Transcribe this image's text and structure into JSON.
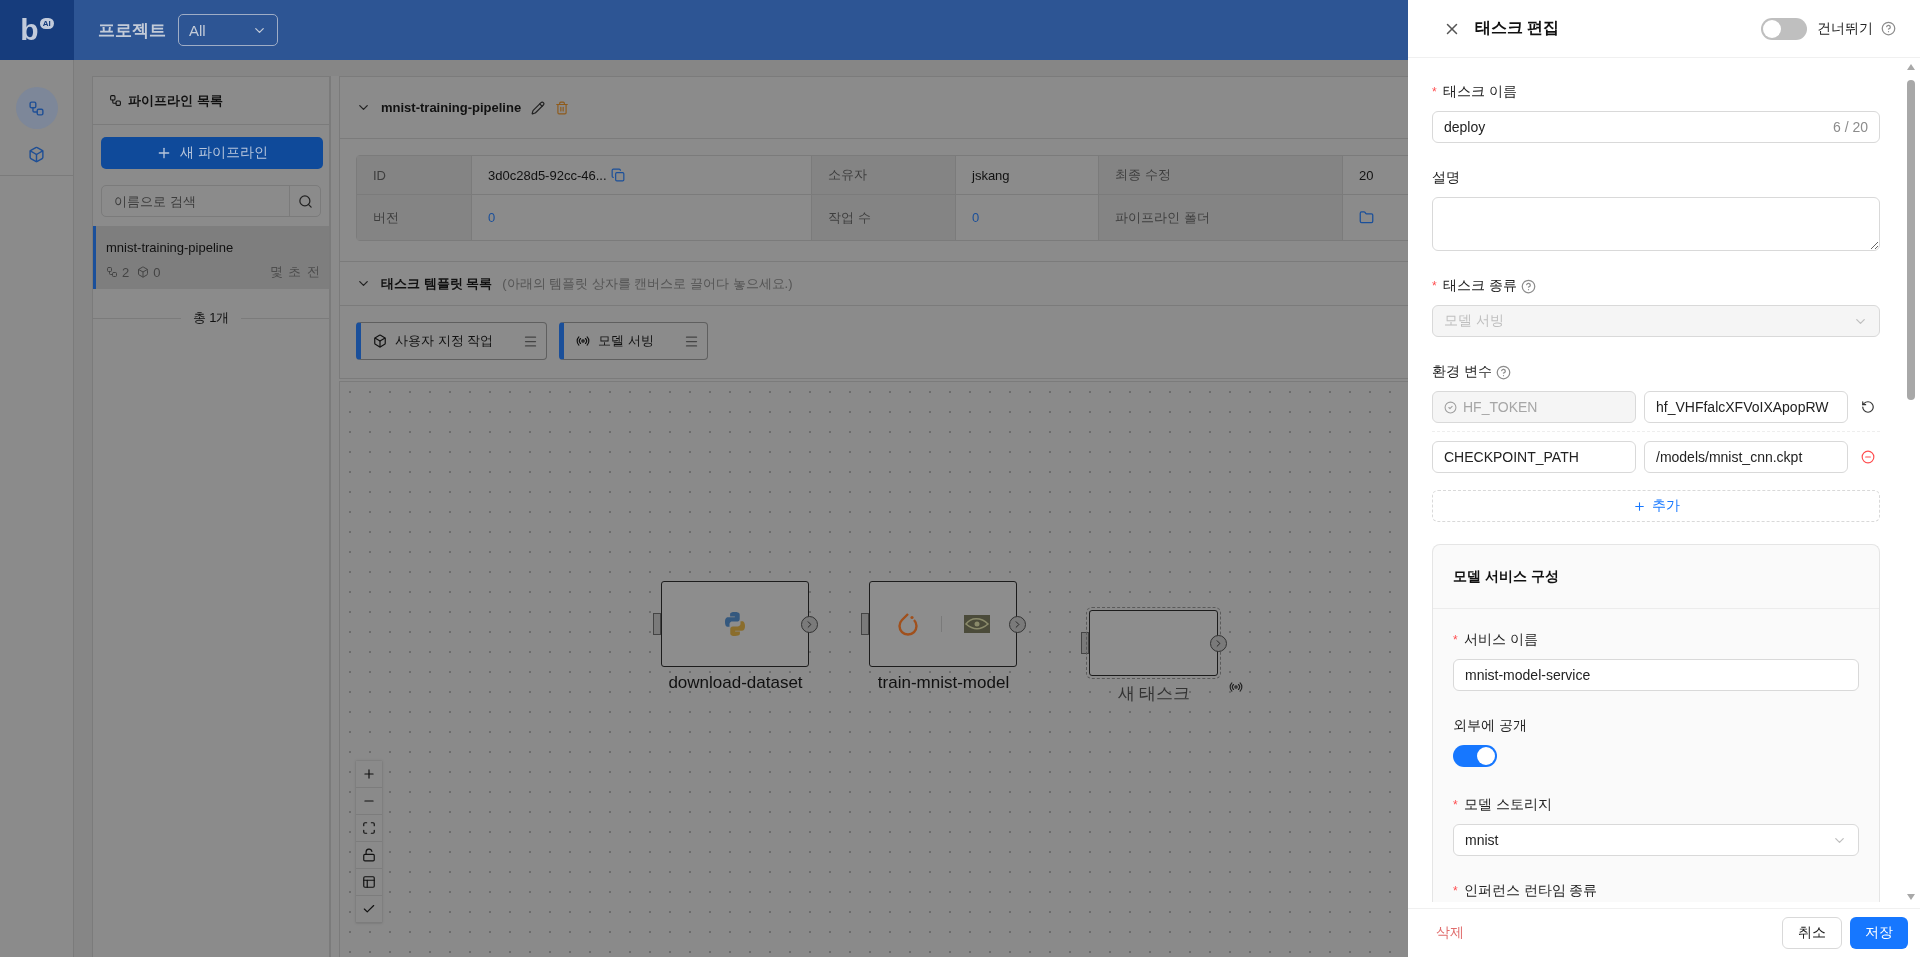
{
  "header": {
    "logo": {
      "letter": "b",
      "badge": "AI"
    },
    "section_label": "프로젝트",
    "project_select": "All"
  },
  "rail": [
    {
      "kind": "pipelines",
      "selected": true
    },
    {
      "kind": "models",
      "selected": false
    }
  ],
  "pipeline_list": {
    "title": "파이프라인 목록",
    "new_button": "새 파이프라인",
    "search_placeholder": "이름으로 검색",
    "total": "총 1개",
    "items": [
      {
        "name": "mnist-training-pipeline",
        "task_count": "2",
        "model_count": "0",
        "time": "몇 초 전",
        "selected": true
      }
    ]
  },
  "pipeline": {
    "name": "mnist-training-pipeline",
    "expanded": true,
    "info_rows": [
      [
        {
          "kind": "label",
          "text": "ID"
        },
        {
          "kind": "copy",
          "text": "3d0c28d5-92cc-46..."
        },
        {
          "kind": "label",
          "text": "소유자"
        },
        {
          "kind": "text",
          "text": "jskang"
        },
        {
          "kind": "label",
          "text": "최종 수정"
        },
        {
          "kind": "text",
          "text": "20"
        }
      ],
      [
        {
          "kind": "label",
          "text": "버전"
        },
        {
          "kind": "link",
          "text": "0"
        },
        {
          "kind": "label",
          "text": "작업 수"
        },
        {
          "kind": "link",
          "text": "0"
        },
        {
          "kind": "label",
          "text": "파이프라인 폴더"
        },
        {
          "kind": "folder"
        }
      ]
    ]
  },
  "templates": {
    "title": "태스크 템플릿 목록",
    "hint": "(아래의 템플릿 상자를 캔버스로 끌어다 놓으세요.)",
    "expanded": true,
    "items": [
      {
        "kind": "custom",
        "label": "사용자 지정 작업"
      },
      {
        "kind": "serving",
        "label": "모델 서빙"
      }
    ]
  },
  "canvas": {
    "nodes": [
      {
        "kind": "python",
        "label": "download-dataset",
        "selected": false
      },
      {
        "kind": "pytorch-nvidia",
        "label": "train-mnist-model",
        "selected": false
      },
      {
        "kind": "empty",
        "label": "새 태스크",
        "selected": true
      }
    ],
    "controls": [
      {
        "kind": "zoom-in"
      },
      {
        "kind": "zoom-out"
      },
      {
        "kind": "fit"
      },
      {
        "kind": "lock"
      },
      {
        "kind": "minimap"
      },
      {
        "kind": "check"
      }
    ]
  },
  "drawer": {
    "title": "태스크 편집",
    "skip": {
      "label": "건너뛰기",
      "on": false
    },
    "fields": [
      {
        "kind": "text",
        "mark": "*",
        "label": "태스크 이름",
        "value": "deploy",
        "counter": "6 / 20"
      },
      {
        "kind": "textarea",
        "label": "설명"
      },
      {
        "kind": "select",
        "mark": "*",
        "label": "태스크 종류",
        "help": true,
        "value": "모델 서빙",
        "disabled": true
      },
      {
        "kind": "env",
        "label": "환경 변수",
        "help": true,
        "add": "추가",
        "rows": [
          {
            "key": "HF_TOKEN",
            "value": "hf_VHFfalcXFVoIXApopRW",
            "locked": true
          },
          {
            "key": "CHECKPOINT_PATH",
            "value": "/models/mnist_cnn.ckpt",
            "locked": false
          }
        ]
      },
      {
        "kind": "section",
        "title": "모델 서비스 구성",
        "fields": [
          {
            "kind": "text",
            "mark": "*",
            "label": "서비스 이름",
            "value": "mnist-model-service"
          },
          {
            "kind": "switch",
            "label": "외부에 공개",
            "on": true
          },
          {
            "kind": "select",
            "mark": "*",
            "label": "모델 스토리지",
            "value": "mnist",
            "disabled": false
          },
          {
            "kind": "label",
            "mark": "*",
            "label": "인퍼런스 런타임 종류"
          }
        ]
      }
    ],
    "footer": {
      "delete": "삭제",
      "cancel": "취소",
      "save": "저장"
    }
  }
}
